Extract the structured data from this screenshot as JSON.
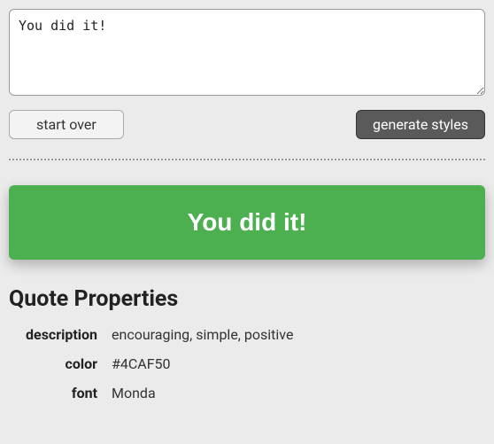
{
  "input": {
    "value": "You did it!"
  },
  "buttons": {
    "start_over": "start over",
    "generate": "generate styles"
  },
  "quote": {
    "text": "You did it!",
    "bg_color": "#4CAF50"
  },
  "properties": {
    "heading": "Quote Properties",
    "rows": [
      {
        "label": "description",
        "value": "encouraging, simple, positive"
      },
      {
        "label": "color",
        "value": "#4CAF50"
      },
      {
        "label": "font",
        "value": "Monda"
      }
    ]
  }
}
